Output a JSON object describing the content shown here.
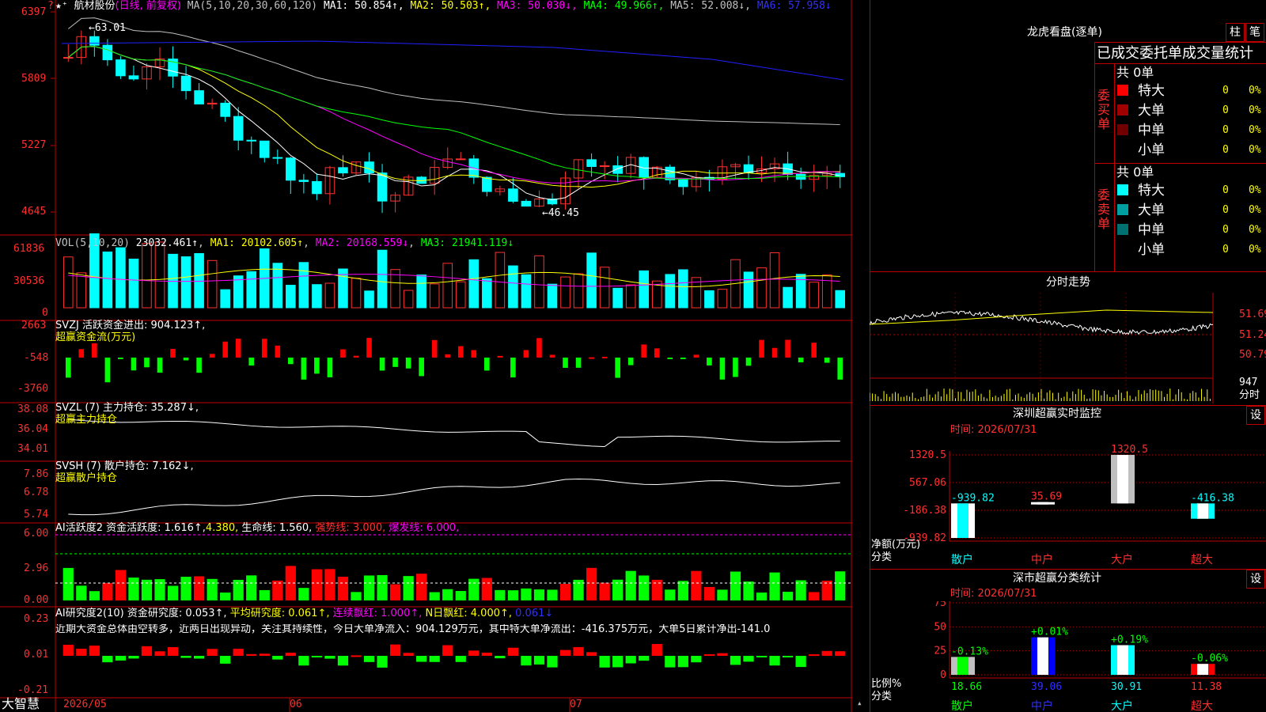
{
  "brand": "大智慧",
  "price_panel": {
    "stock_name": "航材股份",
    "period_note": "(日线, 前复权)",
    "ma_label": "MA(5,10,20,30,60,120)",
    "ma": [
      {
        "name": "MA1",
        "value": "50.854↑",
        "color": "#ffffff"
      },
      {
        "name": "MA2",
        "value": "50.503↑",
        "color": "#ffff00"
      },
      {
        "name": "MA3",
        "value": "50.030↓",
        "color": "#ff00ff"
      },
      {
        "name": "MA4",
        "value": "49.966↑",
        "color": "#00ff00"
      },
      {
        "name": "MA5",
        "value": "52.008↓",
        "color": "#c0c0c0"
      },
      {
        "name": "MA6",
        "value": "57.958↓",
        "color": "#3030ff"
      }
    ],
    "y_ticks": [
      "6397",
      "5809",
      "5227",
      "4645"
    ],
    "high_label": "63.01",
    "low_label": "46.45"
  },
  "vol_panel": {
    "label": "VOL(5,10,20)",
    "value": "23032.461↑",
    "ma1": "MA1: 20102.605↑",
    "ma2": "MA2: 20168.559↓",
    "ma3": "MA3: 21941.119↓",
    "y_ticks": [
      "61836",
      "30536",
      "0"
    ]
  },
  "svzj_panel": {
    "label": "SVZJ  活跃资金进出: 904.123↑,",
    "sub": "超赢资金流(万元)",
    "y_ticks": [
      "2663",
      "-548",
      "-3760"
    ]
  },
  "svzl_panel": {
    "label": "SVZL (7) 主力持仓: 35.287↓,",
    "sub": "超赢主力持仓",
    "y_ticks": [
      "38.08",
      "36.04",
      "34.01"
    ]
  },
  "svsh_panel": {
    "label": "SVSH (7) 散户持仓: 7.162↓,",
    "sub": "超赢散户持仓",
    "y_ticks": [
      "7.86",
      "6.78",
      "5.74"
    ]
  },
  "ai_active_panel": {
    "label1": "AI活跃度2 资金活跃度: 1.616↑,",
    "label2": "4.380,",
    "label3": "生命线: 1.560,",
    "label4": "强势线: 3.000,",
    "label5": "爆发线: 6.000,",
    "y_ticks": [
      "6.00",
      "2.96",
      "0.00"
    ]
  },
  "ai_research_panel": {
    "label1": "AI研究度2(10) 资金研究度: 0.053↑,",
    "label2": "平均研究度: 0.061↑,",
    "label3": "连续飘红: 1.000↑,",
    "label4": "N日飘红: 4.000↑,",
    "label5": "0.061↓",
    "comment": "近期大资金总体由空转多，近两日出现异动，关注其持续性，今日大单净流入：904.129万元，其中特大单净流出：-416.375万元，大单5日累计净出-141.0",
    "y_ticks": [
      "0.23",
      "0.01",
      "-0.21"
    ]
  },
  "x_axis": [
    "2026/05",
    "06",
    "07"
  ],
  "dragon_tiger": {
    "title": "龙虎看盘(逐单)",
    "btn_zhu": "柱",
    "btn_bi": "笔",
    "header": "已成交委托单成交量统计",
    "buy": {
      "side": "委买单",
      "total": "共 0单",
      "rows": [
        {
          "label": "特大",
          "value": "0",
          "pct": "0%",
          "color": "#ff0000"
        },
        {
          "label": "大单",
          "value": "0",
          "pct": "0%",
          "color": "#a00000"
        },
        {
          "label": "中单",
          "value": "0",
          "pct": "0%",
          "color": "#700000"
        },
        {
          "label": "小单",
          "value": "0",
          "pct": "0%",
          "color": "#000000"
        }
      ]
    },
    "sell": {
      "side": "委卖单",
      "total": "共 0单",
      "rows": [
        {
          "label": "特大",
          "value": "0",
          "pct": "0%",
          "color": "#00ffff"
        },
        {
          "label": "大单",
          "value": "0",
          "pct": "0%",
          "color": "#00a0a0"
        },
        {
          "label": "中单",
          "value": "0",
          "pct": "0%",
          "color": "#007070"
        },
        {
          "label": "小单",
          "value": "0",
          "pct": "0%",
          "color": "#000000"
        }
      ]
    }
  },
  "intraday": {
    "title": "分时走势",
    "y_ticks": [
      "51.69",
      "51.24",
      "50.79"
    ],
    "vol_label": "947",
    "vol_unit": "分时"
  },
  "sz_monitor": {
    "title": "深圳超赢实时监控",
    "btn": "设",
    "time": "时间: 2026/07/31",
    "y_ticks": [
      "1320.5",
      "567.06",
      "-186.38",
      "-939.82"
    ],
    "y_unit": "净额(万元)",
    "x_unit": "分类",
    "chart_data": {
      "type": "bar",
      "categories": [
        "散户",
        "中户",
        "大户",
        "超大"
      ],
      "values": [
        -939.82,
        35.69,
        1320.5,
        -416.38
      ],
      "labels": [
        "-939.82",
        "35.69",
        "1320.5",
        "-416.38"
      ],
      "ylim": [
        -939.82,
        1320.5
      ]
    }
  },
  "sz_stats": {
    "title": "深市超赢分类统计",
    "btn": "设",
    "time": "时间: 2026/07/31",
    "y_ticks": [
      "75",
      "50",
      "25",
      "0"
    ],
    "y_unit": "比例%",
    "x_unit": "分类",
    "chart_data": {
      "type": "bar",
      "categories": [
        "散户",
        "中户",
        "大户",
        "超大"
      ],
      "values": [
        18.66,
        39.06,
        30.91,
        11.38
      ],
      "changes": [
        "-0.13%",
        "+0.01%",
        "+0.19%",
        "-0.06%"
      ],
      "ylim": [
        0,
        75
      ]
    }
  }
}
